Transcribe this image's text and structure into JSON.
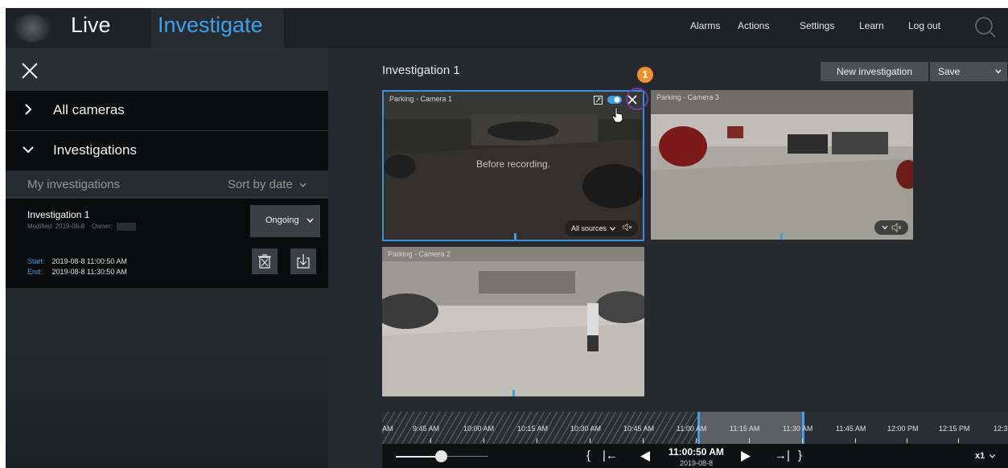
{
  "topbar": {
    "tabs": [
      {
        "label": "Live",
        "active": false
      },
      {
        "label": "Investigate",
        "active": true
      }
    ],
    "nav": [
      "Alarms",
      "Actions",
      "Settings",
      "Learn",
      "Log out"
    ],
    "search_icon": "search-icon",
    "accent_color": "#3ea0e8"
  },
  "sidebar": {
    "close_icon": "close-icon",
    "sections": [
      {
        "label": "All cameras",
        "expanded": false
      },
      {
        "label": "Investigations",
        "expanded": true
      }
    ],
    "list_header": {
      "title": "My investigations",
      "sort": "Sort by date"
    },
    "investigation": {
      "title": "Investigation 1",
      "modified_label": "Modified:",
      "modified": "2019-08-8",
      "owner_label": "Owner:",
      "status": "Ongoing",
      "start_label": "Start:",
      "start": "2019-08-8 11:00:50 AM",
      "end_label": "End:",
      "end": "2019-08-8 11:30:50 AM"
    }
  },
  "main": {
    "title": "Investigation 1",
    "new_button": "New investigation",
    "save_button": "Save",
    "callout": "1",
    "tiles": [
      {
        "name": "Parking - Camera 1",
        "overlay": "Before recording.",
        "sources": "All sources"
      },
      {
        "name": "Parking - Camera 3"
      },
      {
        "name": "Parking - Camera 2"
      }
    ]
  },
  "timeline": {
    "ticks": [
      "AM",
      "9:45 AM",
      "10:00 AM",
      "10:15 AM",
      "10:30 AM",
      "10:45 AM",
      "11:00 AM",
      "11:15 AM",
      "11:30 AM",
      "11:45 AM",
      "12:00 PM",
      "12:15 PM",
      "12:3"
    ],
    "current_time": "11:00:50 AM",
    "current_date": "2019-08-8",
    "speed": "x1"
  }
}
